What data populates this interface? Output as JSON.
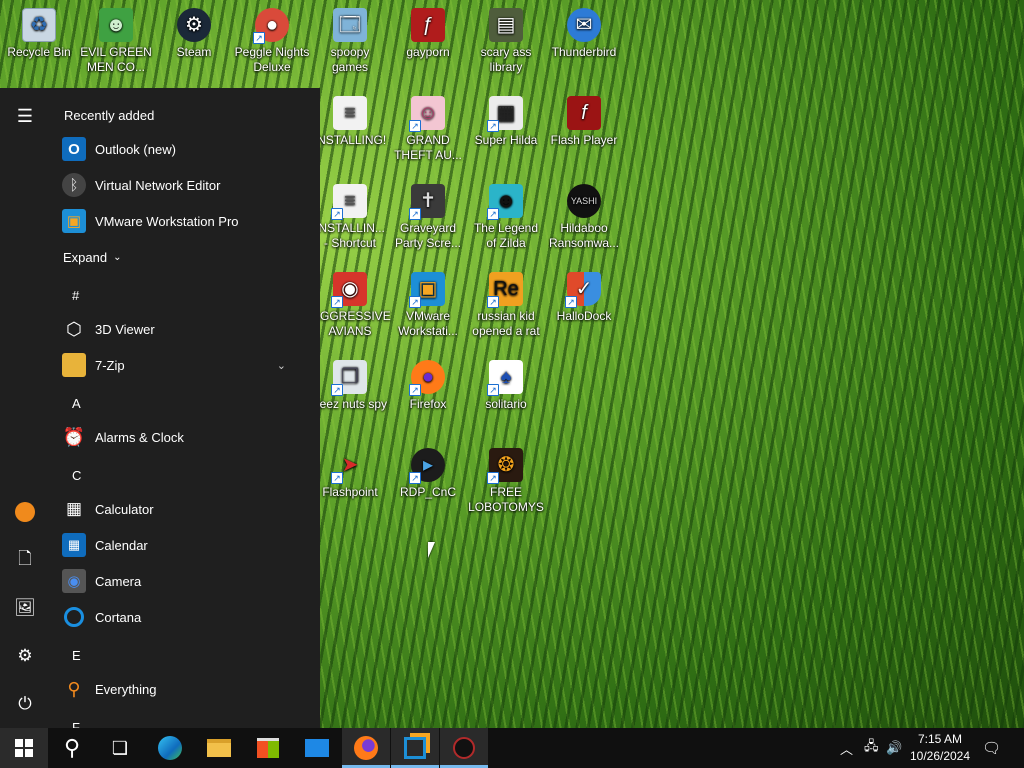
{
  "desktop": {
    "icons": [
      {
        "label": "Recycle Bin",
        "icon": "recycle-bin-icon"
      },
      {
        "label": "EVIL GREEN MEN CO...",
        "icon": "evil-green-men-icon"
      },
      {
        "label": "Steam",
        "icon": "steam-icon"
      },
      {
        "label": "Peggle Nights Deluxe",
        "icon": "peggle-icon"
      },
      {
        "label": "spoopy games",
        "icon": "folder-icon"
      },
      {
        "label": "gayporn",
        "icon": "flash-folder-icon"
      },
      {
        "label": "scary ass library",
        "icon": "library-icon"
      },
      {
        "label": "Thunderbird",
        "icon": "thunderbird-icon"
      },
      {
        "label": "INSTALLING!",
        "icon": "document-icon"
      },
      {
        "label": "GRAND THEFT AU...",
        "icon": "gta-icon"
      },
      {
        "label": "Super Hilda",
        "icon": "super-hilda-icon"
      },
      {
        "label": "Flash Player",
        "icon": "flash-player-icon"
      },
      {
        "label": "INSTALLIN... - Shortcut",
        "icon": "document-shortcut-icon"
      },
      {
        "label": "Graveyard Party Scre...",
        "icon": "graveyard-icon"
      },
      {
        "label": "The Legend of Zilda",
        "icon": "zilda-icon"
      },
      {
        "label": "Hildaboo Ransomwa...",
        "icon": "hildaboo-icon"
      },
      {
        "label": "AGGRESSIVE AVIANS",
        "icon": "angry-bird-icon"
      },
      {
        "label": "VMware Workstati...",
        "icon": "vmware-icon"
      },
      {
        "label": "russian kid opened a rat",
        "icon": "rat-icon"
      },
      {
        "label": "HalloDock",
        "icon": "shield-icon"
      },
      {
        "label": "deez nuts spy",
        "icon": "spy-icon"
      },
      {
        "label": "Firefox",
        "icon": "firefox-icon"
      },
      {
        "label": "solitario",
        "icon": "solitario-icon"
      },
      {
        "label": "Flashpoint",
        "icon": "flashpoint-icon"
      },
      {
        "label": "RDP_CnC",
        "icon": "rdp-icon"
      },
      {
        "label": "FREE LOBOTOMYS",
        "icon": "lobotomy-icon"
      }
    ]
  },
  "start_menu": {
    "recently_added_heading": "Recently added",
    "expand_label": "Expand",
    "apps": [
      {
        "label": "Outlook (new)",
        "icon": "outlook-icon",
        "color": "#0f6cbd"
      },
      {
        "label": "Virtual Network Editor",
        "icon": "network-editor-icon",
        "color": "#444444"
      },
      {
        "label": "VMware Workstation Pro",
        "icon": "vmware-icon",
        "color": "#1d8fd6"
      },
      {
        "label": "3D Viewer",
        "icon": "cube-icon",
        "color": "#1f1f1f"
      },
      {
        "label": "7-Zip",
        "icon": "folder-icon",
        "color": "#e8b33a"
      },
      {
        "label": "Alarms & Clock",
        "icon": "clock-icon",
        "color": "#1f1f1f"
      },
      {
        "label": "Calculator",
        "icon": "calculator-icon",
        "color": "#1f1f1f"
      },
      {
        "label": "Calendar",
        "icon": "calendar-icon",
        "color": "#0f6cbd"
      },
      {
        "label": "Camera",
        "icon": "camera-icon",
        "color": "#555555"
      },
      {
        "label": "Cortana",
        "icon": "cortana-icon",
        "color": "#1f1f1f"
      },
      {
        "label": "Everything",
        "icon": "search-icon",
        "color": "#1f1f1f"
      }
    ],
    "letters": [
      "#",
      "A",
      "C",
      "E",
      "F"
    ]
  },
  "taskbar": {
    "time": "7:15 AM",
    "date": "10/26/2024"
  },
  "colors": {
    "start_menu_bg": "#1f1f1f",
    "taskbar_bg": "#101010",
    "accent": "#76b9ed"
  }
}
